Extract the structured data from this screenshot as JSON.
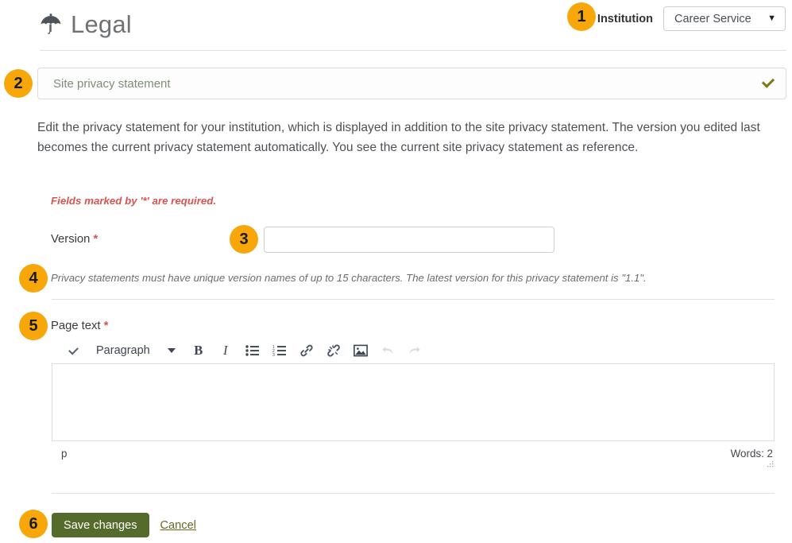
{
  "header": {
    "title": "Legal",
    "icon": "umbrella-icon",
    "institution_label": "Institution",
    "institution_selected": "Career Service",
    "institution_options": [
      "Career Service"
    ],
    "caret": "▼"
  },
  "badges": {
    "b1": "1",
    "b2": "2",
    "b3": "3",
    "b4": "4",
    "b5": "5",
    "b6": "6",
    "color": "#f7a70a"
  },
  "accordion": {
    "label": "Site privacy statement",
    "icon": "chevron-down-icon"
  },
  "intro": "Edit the privacy statement for your institution, which is displayed in addition to the site privacy statement. The version you edited last becomes the current privacy statement automatically. You see the current site privacy statement as reference.",
  "form": {
    "required_note": "Fields marked by '*' are required.",
    "required_star": "*",
    "version_label": "Version",
    "version_value": "",
    "version_placeholder": "",
    "version_help": "Privacy statements must have unique version names of up to 15 characters. The latest version for this privacy statement is \"1.1\".",
    "pagetext_label": "Page text"
  },
  "editor": {
    "toolbar": {
      "collapse_icon": "chevron-down-icon",
      "format_label": "Paragraph",
      "format_caret_icon": "triangle-down-icon",
      "bold_label": "B",
      "italic_label": "I",
      "bullet_list_icon": "bullet-list-icon",
      "numbered_list_icon": "numbered-list-icon",
      "link_icon": "link-icon",
      "unlink_icon": "unlink-icon",
      "image_icon": "image-icon",
      "undo_icon": "undo-icon",
      "redo_icon": "redo-icon"
    },
    "content": "",
    "status_path": "p",
    "word_count": "Words: 2",
    "resize_icon": "resize-grip-icon"
  },
  "footer": {
    "save_label": "Save changes",
    "cancel_label": "Cancel",
    "save_color": "#556b2b",
    "cancel_color": "#6a6a1e"
  }
}
